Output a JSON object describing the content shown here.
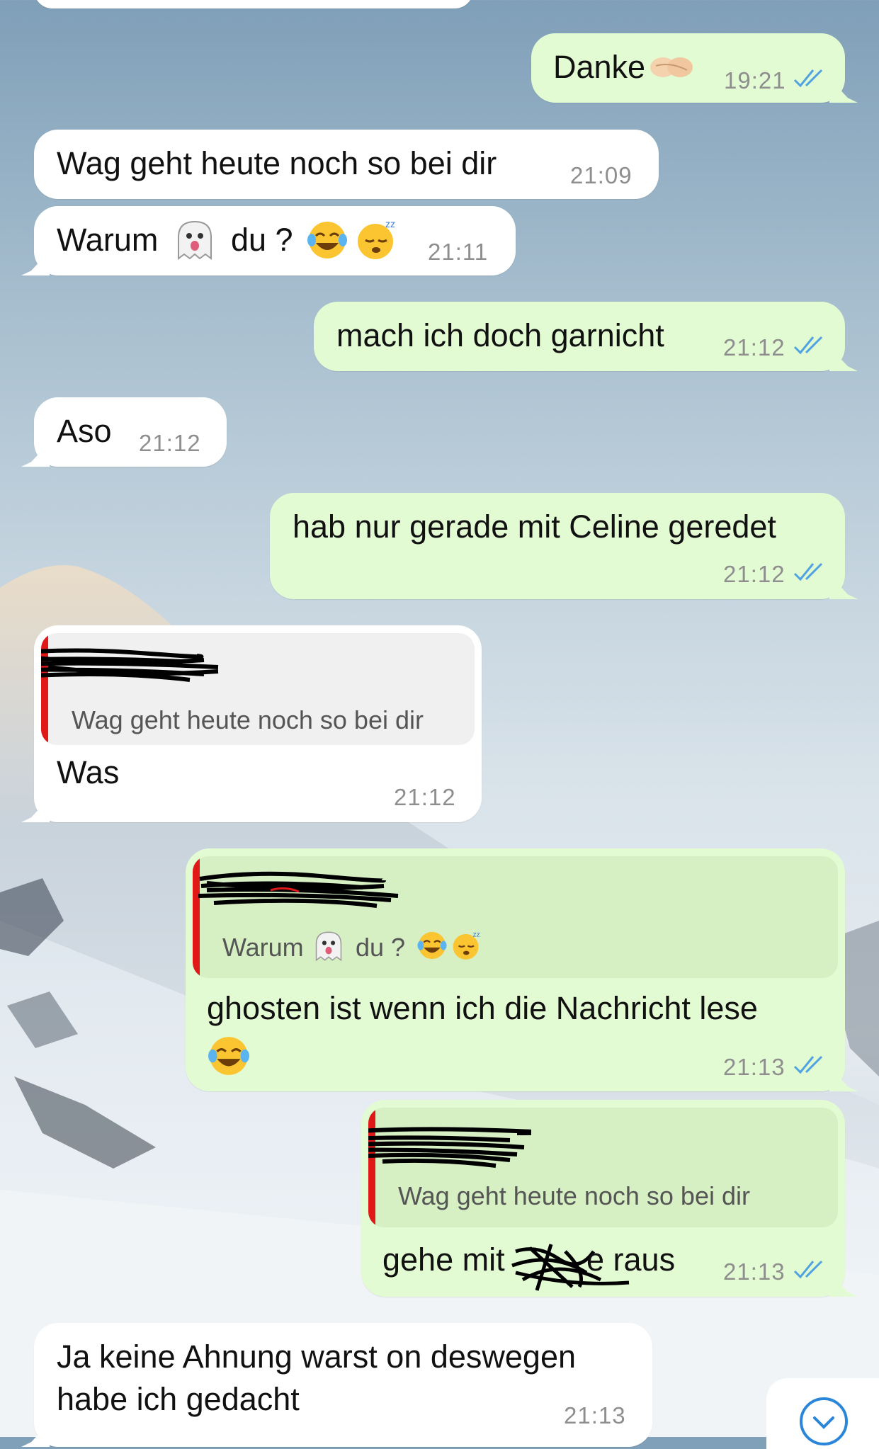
{
  "messages": [
    {
      "id": "m1",
      "dir": "out",
      "text": "Danke",
      "emoji": "handshake-icon",
      "time": "19:21",
      "read": true
    },
    {
      "id": "m2",
      "dir": "in",
      "text": "Wag geht heute noch so bei dir",
      "time": "21:09"
    },
    {
      "id": "m3",
      "dir": "in",
      "text_a": "Warum",
      "text_b": "du ?",
      "emojis": [
        "ghost-icon",
        "tears-of-joy-icon",
        "sleeping-icon"
      ],
      "time": "21:11"
    },
    {
      "id": "m4",
      "dir": "out",
      "text": "mach ich doch garnicht",
      "time": "21:12",
      "read": true
    },
    {
      "id": "m5",
      "dir": "in",
      "text": "Aso",
      "time": "21:12"
    },
    {
      "id": "m6",
      "dir": "out",
      "text": "hab nur gerade mit Celine geredet",
      "time": "21:12",
      "read": true
    },
    {
      "id": "m7",
      "dir": "in",
      "quote": "Wag geht heute noch so bei dir",
      "text": "Was",
      "time": "21:12"
    },
    {
      "id": "m8",
      "dir": "out",
      "quote_a": "Warum",
      "quote_b": "du ?",
      "text": "ghosten ist wenn ich die Nachricht lese",
      "emoji": "tears-of-joy-icon",
      "time": "21:13",
      "read": true
    },
    {
      "id": "m9",
      "dir": "out",
      "quote": "Wag geht heute noch so bei dir",
      "text_a": "gehe mit",
      "text_b": "e raus",
      "time": "21:13",
      "read": true
    },
    {
      "id": "m10",
      "dir": "in",
      "line1": "Ja keine Ahnung warst on deswegen",
      "line2": "habe ich gedacht",
      "time": "21:13"
    }
  ],
  "colors": {
    "outgoing": "#e3fbd3",
    "incoming": "#ffffff",
    "read_ticks": "#4fa3e0",
    "quote_bar": "#e01818"
  },
  "scroll_button": {
    "icon": "chevron-down-icon"
  }
}
